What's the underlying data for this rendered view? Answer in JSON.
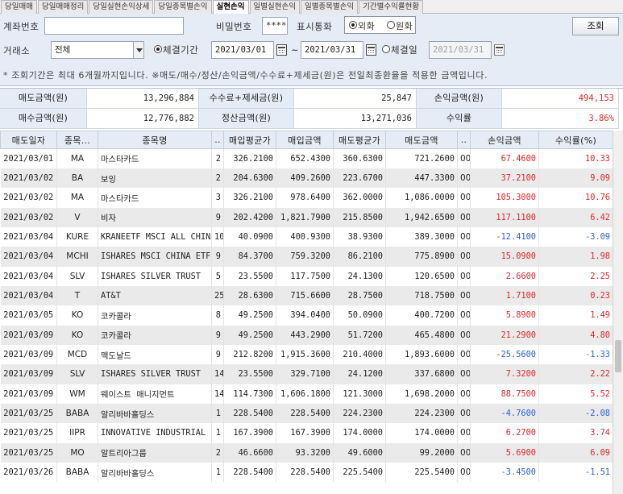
{
  "tabs": [
    "당일매매",
    "당일매매정리",
    "당일실현손익상세",
    "당일종목별손익",
    "실현손익",
    "일별실현손익",
    "일별종목별손익",
    "기간별수익률현황"
  ],
  "active_tab_index": 4,
  "form": {
    "account_label": "계좌번호",
    "account_value": "",
    "password_label": "비밀번호",
    "password_value": "****",
    "currency_label": "표시통화",
    "currency_opt1": "외화",
    "currency_opt2": "원화",
    "query_button": "조회",
    "exchange_label": "거래소",
    "exchange_value": "전체",
    "period_radio": "체결기간",
    "date_from": "2021/03/01",
    "date_sep": "~",
    "date_to": "2021/03/31",
    "day_radio": "체결일",
    "day_value": "2021/03/31",
    "note": "* 조회기간은 최대 6개월까지입니다.    ※매도/매수/정산/손익금액/수수료+제세금(원)은 전일최종환율을 적용한 금액입니다."
  },
  "summary": {
    "sell_label": "매도금액(원)",
    "sell_value": "13,296,884",
    "fee_label": "수수료+제세금(원)",
    "fee_value": "25,847",
    "pl_label": "손익금액(원)",
    "pl_value": "494,153",
    "buy_label": "매수금액(원)",
    "buy_value": "12,776,882",
    "settle_label": "정산금액(원)",
    "settle_value": "13,271,036",
    "rate_label": "수익률",
    "rate_value": "3.86%"
  },
  "table": {
    "headers": [
      "매도일자",
      "종목...",
      "종목명",
      "..",
      "매입평균가",
      "매입금액",
      "매도평균가",
      "매도금액",
      "..",
      "손익금액",
      "수익률(%)"
    ],
    "rows": [
      {
        "date": "2021/03/01",
        "code": "MA",
        "name": "마스타카드",
        "qty": "2",
        "buy_avg": "326.2100",
        "buy_amt": "652.4300",
        "sell_avg": "360.6300",
        "sell_amt": "721.2600",
        "cur": "00",
        "pl": "67.4600",
        "rate": "10.33",
        "sign": "pos"
      },
      {
        "date": "2021/03/02",
        "code": "BA",
        "name": "보잉",
        "qty": "2",
        "buy_avg": "204.6300",
        "buy_amt": "409.2600",
        "sell_avg": "223.6700",
        "sell_amt": "447.3300",
        "cur": "00",
        "pl": "37.2100",
        "rate": "9.09",
        "sign": "pos"
      },
      {
        "date": "2021/03/02",
        "code": "MA",
        "name": "마스타카드",
        "qty": "3",
        "buy_avg": "326.2100",
        "buy_amt": "978.6400",
        "sell_avg": "362.0000",
        "sell_amt": "1,086.0000",
        "cur": "00",
        "pl": "105.3000",
        "rate": "10.76",
        "sign": "pos"
      },
      {
        "date": "2021/03/02",
        "code": "V",
        "name": "비자",
        "qty": "9",
        "buy_avg": "202.4200",
        "buy_amt": "1,821.7900",
        "sell_avg": "215.8500",
        "sell_amt": "1,942.6500",
        "cur": "00",
        "pl": "117.1100",
        "rate": "6.42",
        "sign": "pos"
      },
      {
        "date": "2021/03/04",
        "code": "KURE",
        "name": "KRANEETF MSCI ALL CHINA",
        "qty": "10",
        "buy_avg": "40.0900",
        "buy_amt": "400.9300",
        "sell_avg": "38.9300",
        "sell_amt": "389.3000",
        "cur": "00",
        "pl": "-12.4100",
        "rate": "-3.09",
        "sign": "neg"
      },
      {
        "date": "2021/03/04",
        "code": "MCHI",
        "name": "ISHARES MSCI CHINA ETF",
        "qty": "9",
        "buy_avg": "84.3700",
        "buy_amt": "759.3200",
        "sell_avg": "86.2100",
        "sell_amt": "775.8900",
        "cur": "00",
        "pl": "15.0900",
        "rate": "1.98",
        "sign": "pos"
      },
      {
        "date": "2021/03/04",
        "code": "SLV",
        "name": "ISHARES SILVER TRUST",
        "qty": "5",
        "buy_avg": "23.5500",
        "buy_amt": "117.7500",
        "sell_avg": "24.1300",
        "sell_amt": "120.6500",
        "cur": "00",
        "pl": "2.6600",
        "rate": "2.25",
        "sign": "pos"
      },
      {
        "date": "2021/03/04",
        "code": "T",
        "name": "AT&T",
        "qty": "25",
        "buy_avg": "28.6300",
        "buy_amt": "715.6600",
        "sell_avg": "28.7500",
        "sell_amt": "718.7500",
        "cur": "00",
        "pl": "1.7100",
        "rate": "0.23",
        "sign": "pos"
      },
      {
        "date": "2021/03/05",
        "code": "KO",
        "name": "코카콜라",
        "qty": "8",
        "buy_avg": "49.2500",
        "buy_amt": "394.0400",
        "sell_avg": "50.0900",
        "sell_amt": "400.7200",
        "cur": "00",
        "pl": "5.8900",
        "rate": "1.49",
        "sign": "pos"
      },
      {
        "date": "2021/03/09",
        "code": "KO",
        "name": "코카콜라",
        "qty": "9",
        "buy_avg": "49.2500",
        "buy_amt": "443.2900",
        "sell_avg": "51.7200",
        "sell_amt": "465.4800",
        "cur": "00",
        "pl": "21.2900",
        "rate": "4.80",
        "sign": "pos"
      },
      {
        "date": "2021/03/09",
        "code": "MCD",
        "name": "맥도날드",
        "qty": "9",
        "buy_avg": "212.8200",
        "buy_amt": "1,915.3600",
        "sell_avg": "210.4000",
        "sell_amt": "1,893.6000",
        "cur": "00",
        "pl": "-25.5600",
        "rate": "-1.33",
        "sign": "neg"
      },
      {
        "date": "2021/03/09",
        "code": "SLV",
        "name": "ISHARES SILVER TRUST",
        "qty": "14",
        "buy_avg": "23.5500",
        "buy_amt": "329.7100",
        "sell_avg": "24.1200",
        "sell_amt": "337.6800",
        "cur": "00",
        "pl": "7.3200",
        "rate": "2.22",
        "sign": "pos"
      },
      {
        "date": "2021/03/09",
        "code": "WM",
        "name": "웨이스트 매니지먼트",
        "qty": "14",
        "buy_avg": "114.7300",
        "buy_amt": "1,606.1800",
        "sell_avg": "121.3000",
        "sell_amt": "1,698.2000",
        "cur": "00",
        "pl": "88.7500",
        "rate": "5.52",
        "sign": "pos"
      },
      {
        "date": "2021/03/25",
        "code": "BABA",
        "name": "알리바바홀딩스",
        "qty": "1",
        "buy_avg": "228.5400",
        "buy_amt": "228.5400",
        "sell_avg": "224.2300",
        "sell_amt": "224.2300",
        "cur": "00",
        "pl": "-4.7600",
        "rate": "-2.08",
        "sign": "neg"
      },
      {
        "date": "2021/03/25",
        "code": "IIPR",
        "name": "INNOVATIVE INDUSTRIAL P",
        "qty": "1",
        "buy_avg": "167.3900",
        "buy_amt": "167.3900",
        "sell_avg": "174.0000",
        "sell_amt": "174.0000",
        "cur": "00",
        "pl": "6.2700",
        "rate": "3.74",
        "sign": "pos"
      },
      {
        "date": "2021/03/25",
        "code": "MO",
        "name": "알트리아그룹",
        "qty": "2",
        "buy_avg": "46.6600",
        "buy_amt": "93.3200",
        "sell_avg": "49.6000",
        "sell_amt": "99.2000",
        "cur": "00",
        "pl": "5.6900",
        "rate": "6.09",
        "sign": "pos"
      },
      {
        "date": "2021/03/26",
        "code": "BABA",
        "name": "알리바바홀딩스",
        "qty": "1",
        "buy_avg": "228.5400",
        "buy_amt": "228.5400",
        "sell_avg": "225.5400",
        "sell_amt": "225.5400",
        "cur": "00",
        "pl": "-3.4500",
        "rate": "-1.51",
        "sign": "neg"
      }
    ]
  },
  "colors": {
    "positive": "#e0262a",
    "negative": "#2a5fd8",
    "header_bg": "#e6ecf6",
    "alt_row": "#eaeaea"
  }
}
